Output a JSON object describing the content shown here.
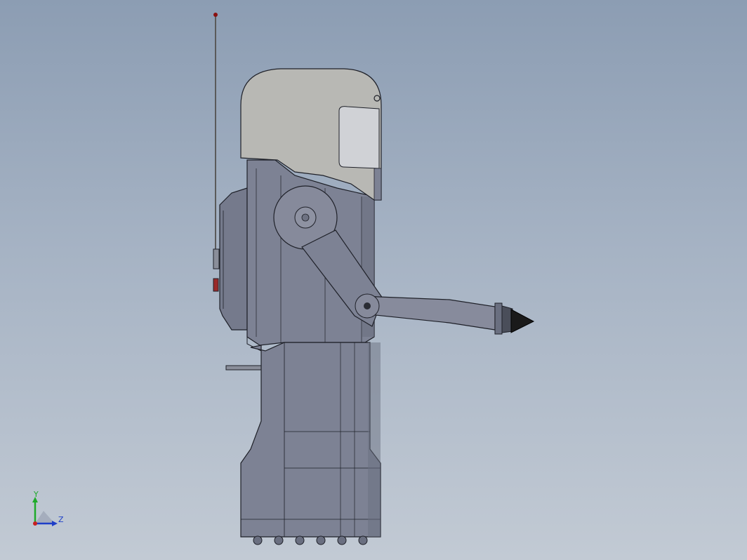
{
  "viewport": {
    "background_top": "#8c9db3",
    "background_bottom": "#c2cad4"
  },
  "model": {
    "body_color": "#7d8294",
    "body_shade": "#6a6f80",
    "helmet_color": "#b8b8b4",
    "visor_color": "#d0d2d6",
    "edge_color": "#1e2028",
    "antenna_tip_color": "#8a1010",
    "nozzle_color": "#1a1a1a"
  },
  "triad": {
    "y_label": "Y",
    "z_label": "Z",
    "y_color": "#1faa2a",
    "z_color": "#1f3fc8",
    "x_color": "#c82020"
  }
}
